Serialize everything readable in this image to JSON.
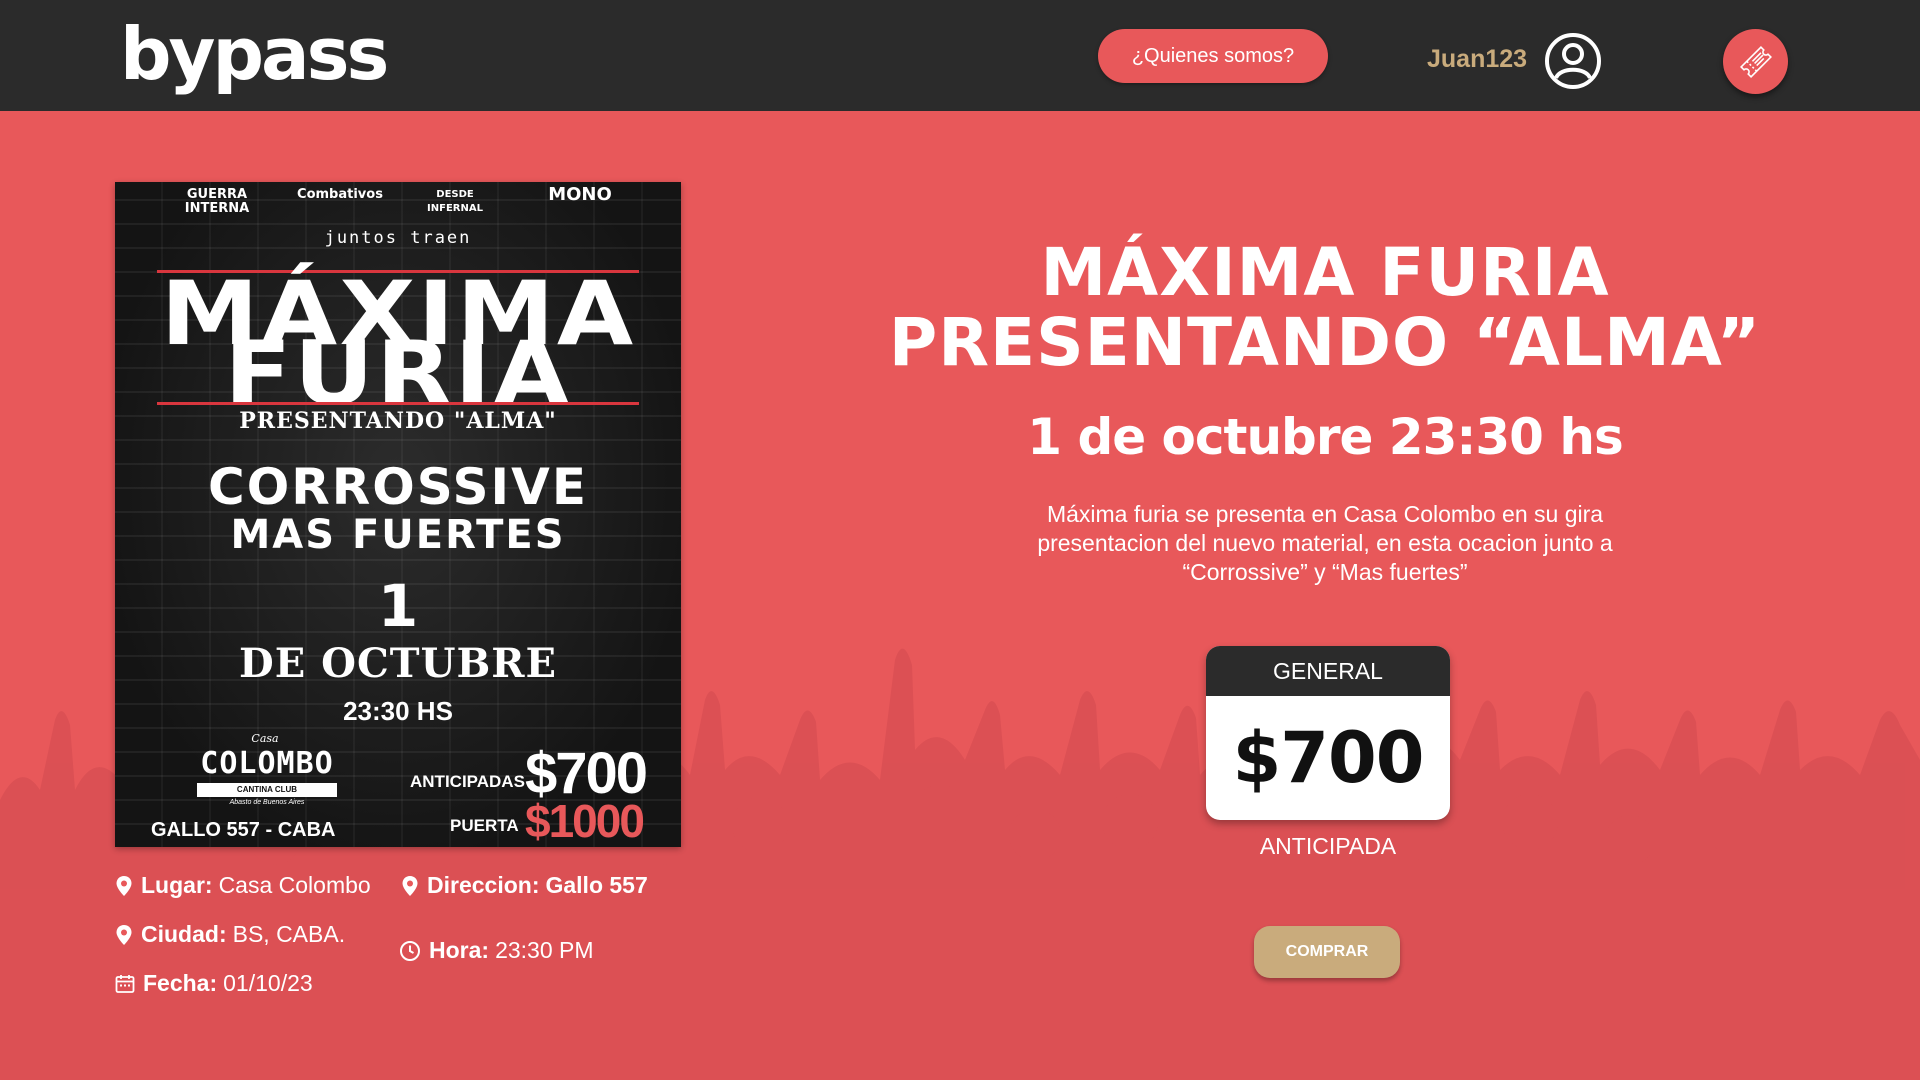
{
  "header": {
    "logo": "bypass",
    "about_label": "¿Quienes somos?",
    "username": "Juan123",
    "user_icon": "user-circle-icon",
    "ticket_icon": "ticket-icon"
  },
  "poster": {
    "sponsors": [
      "GUERRA INTERNA",
      "Combativos",
      "DESDE INFERNAL",
      "MONO"
    ],
    "juntos": "juntos traen",
    "band_line1": "MÁXIMA",
    "band_line2": "FURIA",
    "presentando": "PRESENTANDO \"ALMA\"",
    "support1": "CORROSSIVE",
    "support2": "MAS FUERTES",
    "day": "1",
    "month": "DE OCTUBRE",
    "time": "23:30 HS",
    "venue_small": "Casa",
    "venue": "COLOMBO",
    "venue_tag": "CANTINA CLUB",
    "venue_barrio": "Abasto de Buenos Aires",
    "address": "GALLO 557 - CABA",
    "label_anticipadas": "ANTICIPADAS",
    "price_anticipadas": "$700",
    "label_puerta": "PUERTA",
    "price_puerta": "$1000"
  },
  "info": {
    "lugar_label": "Lugar:",
    "lugar_value": "Casa Colombo",
    "direccion_label": "Direccion:",
    "direccion_value": "Gallo 557",
    "ciudad_label": "Ciudad:",
    "ciudad_value": "BS, CABA.",
    "hora_label": "Hora:",
    "hora_value": "23:30 PM",
    "fecha_label": "Fecha:",
    "fecha_value": "01/10/23"
  },
  "event": {
    "title_line1": "MÁXIMA FURIA",
    "title_line2": "PRESENTANDO “ALMA”",
    "date": "1 de octubre 23:30 hs",
    "description": "Máxima furia se presenta en Casa Colombo en su gira presentacion del nuevo material, en esta ocacion junto a “Corrossive” y “Mas fuertes”"
  },
  "ticket": {
    "type": "GENERAL",
    "price": "$700",
    "subtitle": "ANTICIPADA",
    "buy_label": "COMPRAR"
  },
  "colors": {
    "background": "#e8585a",
    "header": "#2b2b2b",
    "gold": "#c9ab7c"
  }
}
